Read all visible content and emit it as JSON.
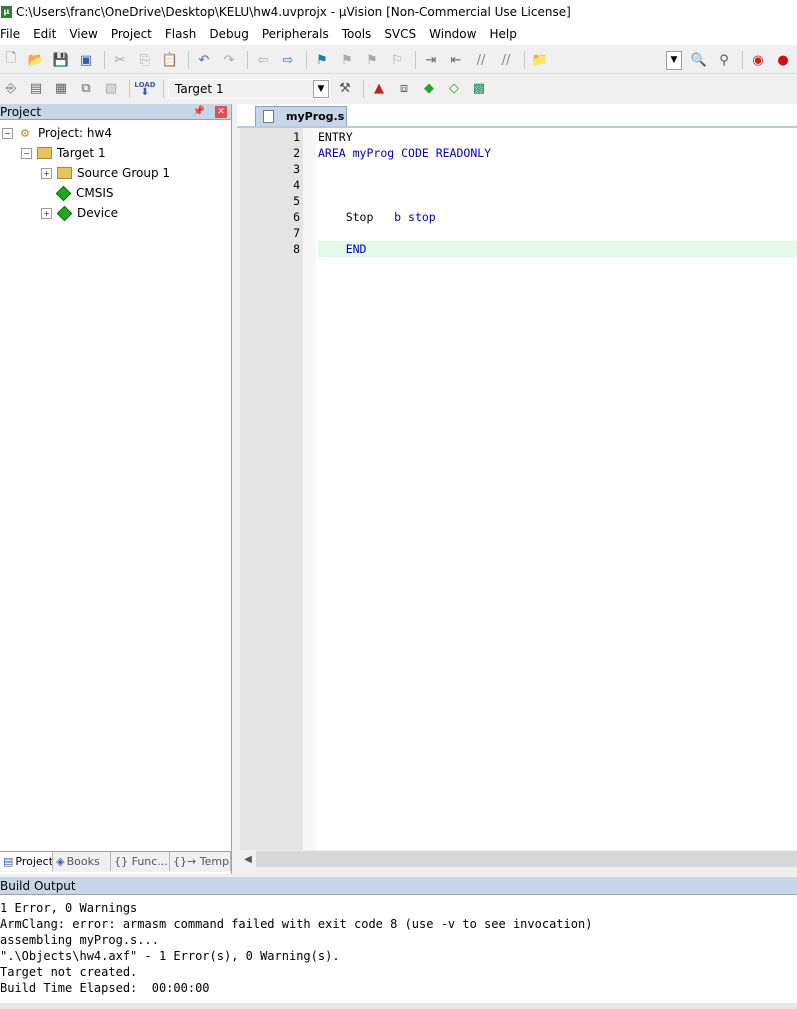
{
  "window": {
    "title": "C:\\Users\\franc\\OneDrive\\Desktop\\KELU\\hw4.uvprojx - µVision  [Non-Commercial Use License]"
  },
  "menu": [
    "File",
    "Edit",
    "View",
    "Project",
    "Flash",
    "Debug",
    "Peripherals",
    "Tools",
    "SVCS",
    "Window",
    "Help"
  ],
  "toolbar2": {
    "target_label": "Target 1",
    "load_label": "LOAD"
  },
  "project_panel": {
    "title": "Project",
    "root": "Project: hw4",
    "target": "Target 1",
    "items": [
      "Source Group 1",
      "CMSIS",
      "Device"
    ],
    "tabs": [
      "Project",
      "Books",
      "{} Func...",
      "{}→ Temp..."
    ]
  },
  "editor": {
    "file_tab": "myProg.s",
    "lines": [
      {
        "num": "1",
        "label": "ENTRY",
        "rest": ""
      },
      {
        "num": "2",
        "label": "AREA",
        "rest": " myProg CODE READONLY"
      },
      {
        "num": "3",
        "label": "",
        "rest": ""
      },
      {
        "num": "4",
        "label": "",
        "rest": ""
      },
      {
        "num": "5",
        "label": "",
        "rest": ""
      },
      {
        "num": "6",
        "label": "    Stop   ",
        "rest": "b stop"
      },
      {
        "num": "7",
        "label": "",
        "rest": ""
      },
      {
        "num": "8",
        "label": "    ",
        "rest": "END"
      }
    ]
  },
  "build_output": {
    "title": "Build Output",
    "lines": [
      "1 Error, 0 Warnings",
      "ArmClang: error: armasm command failed with exit code 8 (use -v to see invocation)",
      "assembling myProg.s...",
      "\".\\Objects\\hw4.axf\" - 1 Error(s), 0 Warning(s).",
      "Target not created.",
      "Build Time Elapsed:  00:00:00"
    ]
  }
}
